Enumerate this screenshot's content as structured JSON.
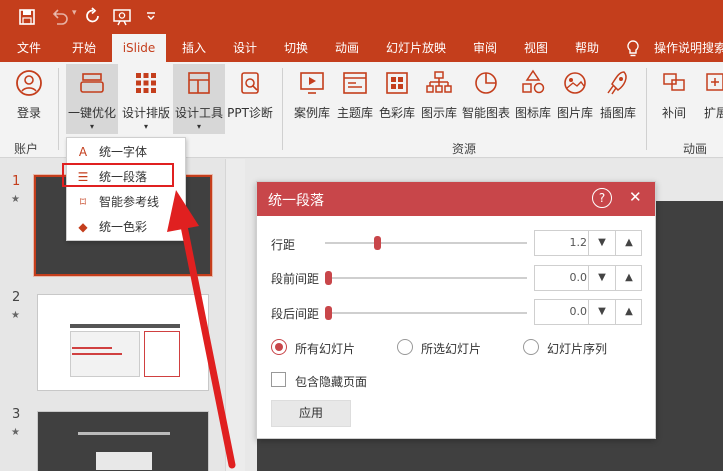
{
  "titlebar": {
    "icons": [
      "save-icon",
      "undo-icon",
      "redo-icon",
      "present-from-start-icon",
      "customize-toolbar-icon"
    ]
  },
  "tabs": [
    "文件",
    "开始",
    "iSlide",
    "插入",
    "设计",
    "切换",
    "动画",
    "幻灯片放映",
    "审阅",
    "视图",
    "帮助"
  ],
  "search": {
    "label": "操作说明搜索"
  },
  "ribbon": {
    "account": {
      "login": "登录",
      "group": "账户"
    },
    "tools": [
      {
        "label": "一键优化",
        "dropdown": "▾"
      },
      {
        "label": "设计排版",
        "dropdown": "▾"
      },
      {
        "label": "设计工具",
        "dropdown": "▾"
      },
      {
        "label": "PPT诊断"
      }
    ],
    "resources": [
      "案例库",
      "主题库",
      "色彩库",
      "图示库",
      "智能图表",
      "图标库",
      "图片库",
      "插图库"
    ],
    "resource_group": "资源",
    "animation": [
      "补间",
      "扩展"
    ],
    "animation_group": "动画"
  },
  "menu": {
    "items": [
      "统一字体",
      "统一段落",
      "智能参考线",
      "统一色彩"
    ]
  },
  "slides": [
    {
      "number": "1",
      "star": "★"
    },
    {
      "number": "2",
      "star": "★"
    },
    {
      "number": "3",
      "star": "★"
    }
  ],
  "dialog": {
    "title": "统一段落",
    "help": "?",
    "close": "✕",
    "rows": [
      {
        "label": "行距",
        "value": "1.2",
        "level": 0.25
      },
      {
        "label": "段前间距",
        "value": "0.0",
        "level": 0
      },
      {
        "label": "段后间距",
        "value": "0.0",
        "level": 0
      }
    ],
    "scope_options": [
      "所有幻灯片",
      "所选幻灯片",
      "幻灯片序列"
    ],
    "selected_scope": 0,
    "include_hidden": "包含隐藏页面",
    "apply": "应用"
  },
  "colors": {
    "brand": "#c43e1c",
    "dialog_head": "#c8464a",
    "highlight": "#e02020"
  }
}
